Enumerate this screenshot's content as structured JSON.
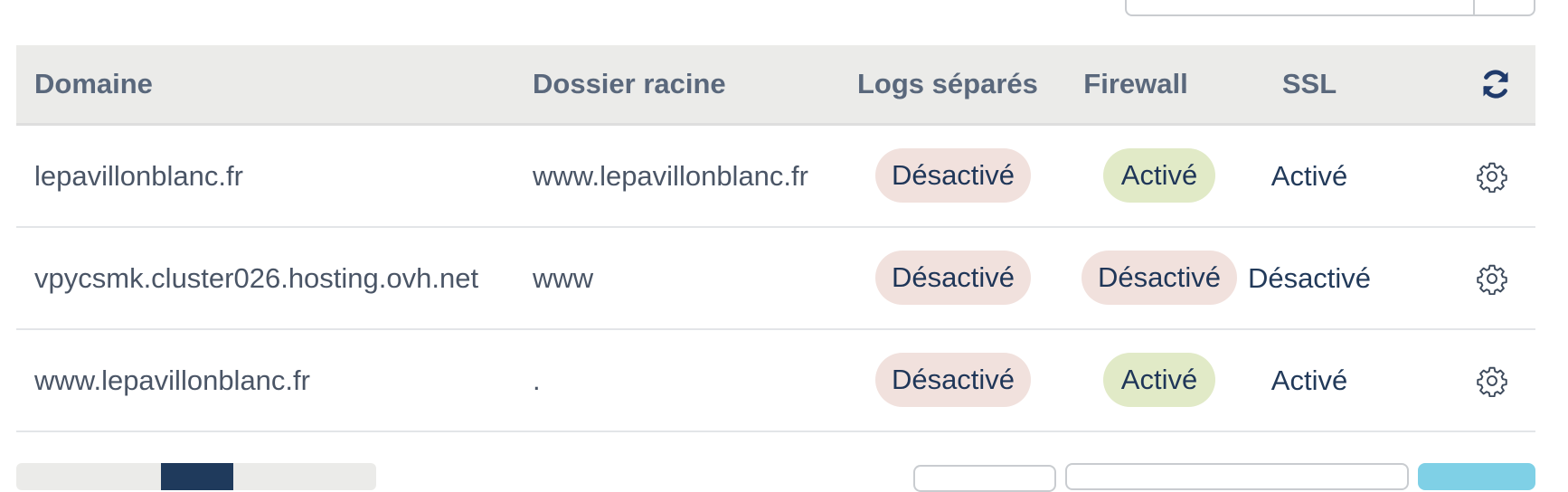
{
  "table": {
    "headers": {
      "domain": "Domaine",
      "root": "Dossier racine",
      "logs": "Logs séparés",
      "firewall": "Firewall",
      "ssl": "SSL"
    },
    "rows": [
      {
        "domain": "lepavillonblanc.fr",
        "root": "www.lepavillonblanc.fr",
        "logs": "Désactivé",
        "firewall": "Activé",
        "ssl": "Activé"
      },
      {
        "domain": "vpycsmk.cluster026.hosting.ovh.net",
        "root": "www",
        "logs": "Désactivé",
        "firewall": "Désactivé",
        "ssl": "Désactivé"
      },
      {
        "domain": "www.lepavillonblanc.fr",
        "root": ".",
        "logs": "Désactivé",
        "firewall": "Activé",
        "ssl": "Activé"
      }
    ]
  },
  "icons": {
    "refresh": "refresh-icon",
    "settings": "gear-icon"
  },
  "colors": {
    "header_bg": "#ebebe9",
    "header_text": "#5a687c",
    "badge_off_bg": "#f1e1dd",
    "badge_on_bg": "#e1eac7",
    "accent": "#1f3a5c",
    "refresh_icon": "#1f3a6b"
  }
}
